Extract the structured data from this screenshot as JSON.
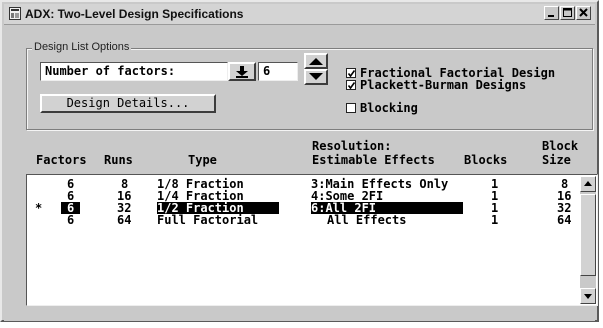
{
  "window": {
    "title": "ADX: Two-Level Design Specifications"
  },
  "options": {
    "group_label": "Design List Options",
    "factors_label": "Number of factors:",
    "factors_value": "6",
    "details_button": "Design Details...",
    "checkboxes": [
      {
        "label": "Fractional Factorial Design",
        "checked": true
      },
      {
        "label": "Plackett-Burman Designs",
        "checked": true
      },
      {
        "label": "Blocking",
        "checked": false
      }
    ]
  },
  "table": {
    "headers": {
      "factors": "Factors",
      "runs": "Runs",
      "type": "Type",
      "resolution_line1": "Resolution:",
      "resolution_line2": "Estimable Effects",
      "blocks": "Blocks",
      "block_size_line1": "Block",
      "block_size_line2": "Size"
    },
    "rows": [
      {
        "marker": "",
        "factors": "6",
        "runs": "8",
        "type": "1/8 Fraction",
        "resolution": "3:Main Effects Only",
        "blocks": "1",
        "block_size": "8",
        "selected": false
      },
      {
        "marker": "",
        "factors": "6",
        "runs": "16",
        "type": "1/4 Fraction",
        "resolution": "4:Some 2FI",
        "blocks": "1",
        "block_size": "16",
        "selected": false
      },
      {
        "marker": "*",
        "factors": "6",
        "runs": "32",
        "type": "1/2 Fraction",
        "resolution": "6:All 2FI",
        "blocks": "1",
        "block_size": "32",
        "selected": true
      },
      {
        "marker": "",
        "factors": "6",
        "runs": "64",
        "type": "Full Factorial",
        "resolution": "All Effects",
        "blocks": "1",
        "block_size": "64",
        "selected": false
      }
    ]
  }
}
